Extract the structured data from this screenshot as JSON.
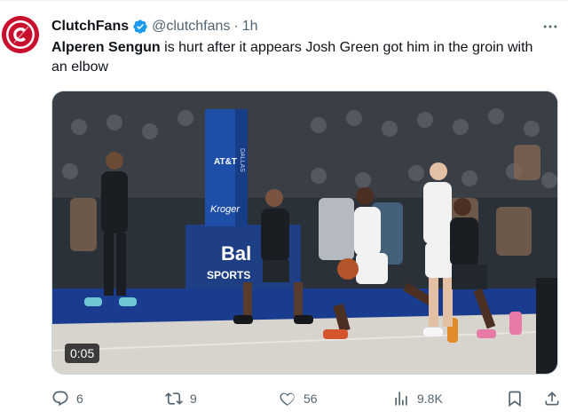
{
  "tweet": {
    "author": {
      "display_name": "ClutchFans",
      "handle": "@clutchfans",
      "verified": true,
      "avatar_icon": "clutchfans-logo",
      "avatar_color": "#c8102e"
    },
    "separator": "·",
    "timestamp": "1h",
    "text": {
      "bold": "Alperen Sengun",
      "rest": " is hurt after it appears Josh Green got him in the groin with an elbow"
    },
    "media": {
      "type": "video",
      "duration": "0:05",
      "court_signage": {
        "att": "AT&T",
        "kroger": "Kroger",
        "ballys": "Bal",
        "sports": "SPORTS",
        "bank": "DALLAS"
      }
    },
    "actions": {
      "replies": "6",
      "reposts": "9",
      "likes": "56",
      "views": "9.8K"
    }
  },
  "colors": {
    "text": "#0f1419",
    "secondary": "#536471",
    "verified": "#1d9bf0",
    "border": "#cfd9de"
  }
}
